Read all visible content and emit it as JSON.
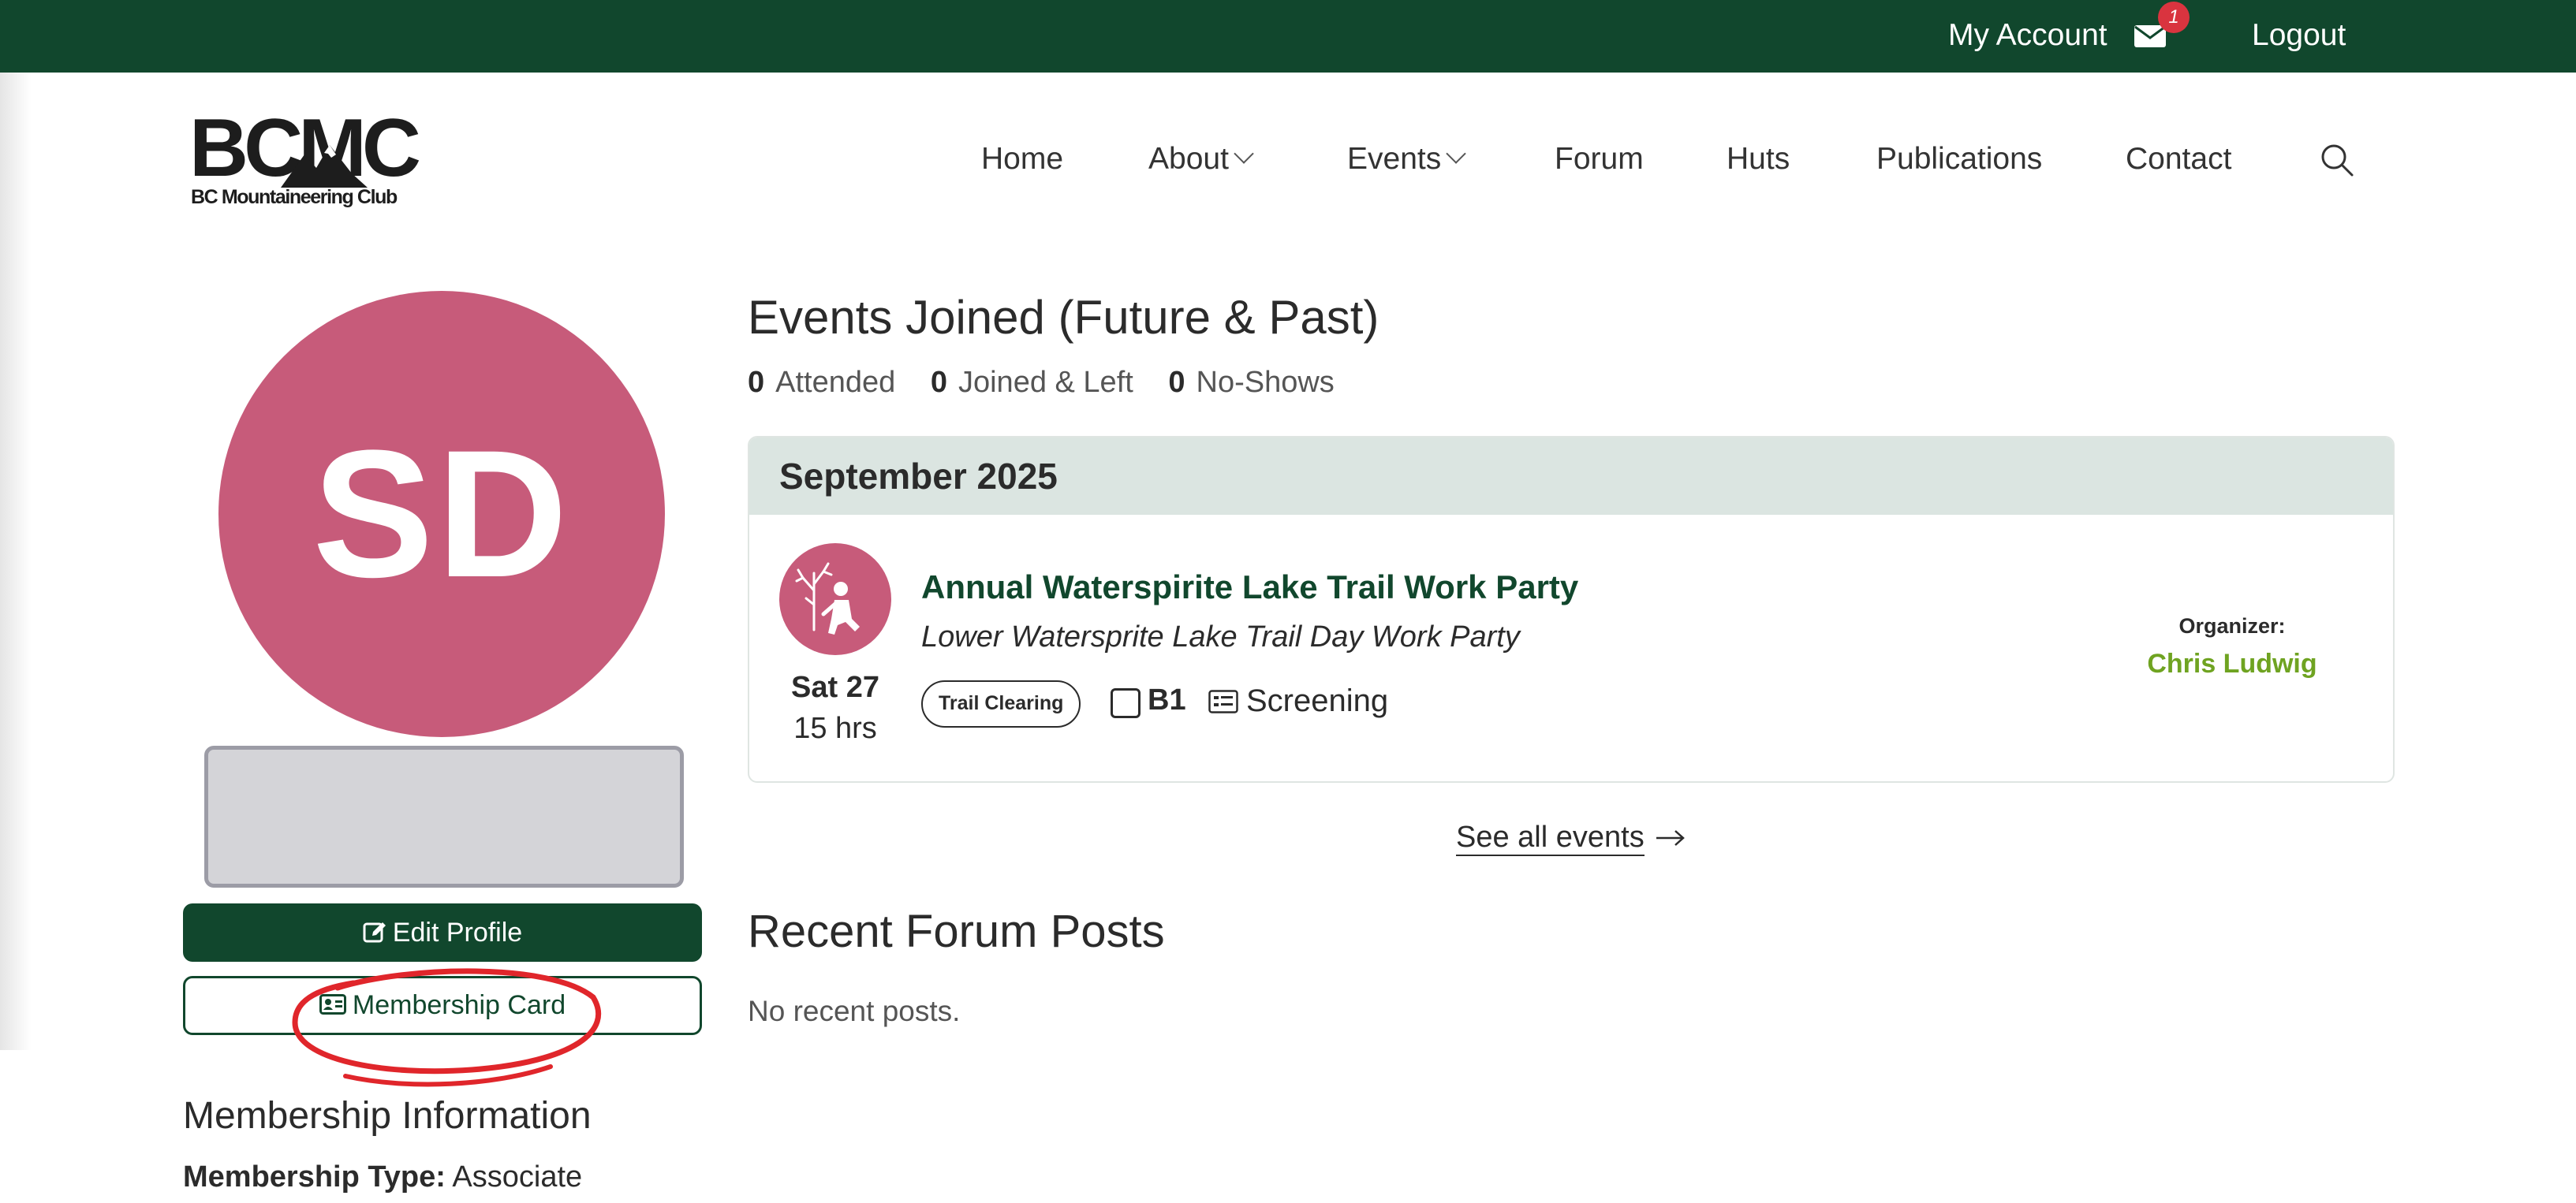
{
  "topbar": {
    "my_account": "My Account",
    "notification_count": "1",
    "logout": "Logout",
    "mail_icon": "mail-icon"
  },
  "brand": {
    "logo_text": "BCMC",
    "logo_subtext": "BC Mountaineering Club"
  },
  "nav": {
    "items": [
      {
        "label": "Home",
        "dropdown": false
      },
      {
        "label": "About",
        "dropdown": true
      },
      {
        "label": "Events",
        "dropdown": true
      },
      {
        "label": "Forum",
        "dropdown": false
      },
      {
        "label": "Huts",
        "dropdown": false
      },
      {
        "label": "Publications",
        "dropdown": false
      },
      {
        "label": "Contact",
        "dropdown": false
      }
    ],
    "search_icon": "search-icon"
  },
  "profile": {
    "initials": "SD",
    "avatar_color": "#c75b7a",
    "edit_profile": "Edit Profile",
    "membership_card": "Membership Card"
  },
  "membership": {
    "title": "Membership Information",
    "type_label": "Membership Type:",
    "type_value": "Associate"
  },
  "events": {
    "title": "Events Joined (Future & Past)",
    "attended_count": "0",
    "attended_label": "Attended",
    "joined_left_count": "0",
    "joined_left_label": "Joined & Left",
    "no_shows_count": "0",
    "no_shows_label": "No-Shows",
    "month": "September 2025",
    "items": [
      {
        "name": "Annual Waterspirite Lake Trail Work Party",
        "subtitle": "Lower Watersprite Lake Trail Day Work Party",
        "date": "Sat 27",
        "duration": "15 hrs",
        "tag": "Trail Clearing",
        "grade": "B1",
        "screening": "Screening",
        "organizer_label": "Organizer:",
        "organizer_name": "Chris Ludwig"
      }
    ],
    "see_all": "See all events"
  },
  "forum": {
    "title": "Recent Forum Posts",
    "empty": "No recent posts."
  },
  "colors": {
    "brand_green": "#11472d",
    "accent_pink": "#c75b7a",
    "organizer_green": "#6fa321",
    "annotation_red": "#e0262b"
  }
}
